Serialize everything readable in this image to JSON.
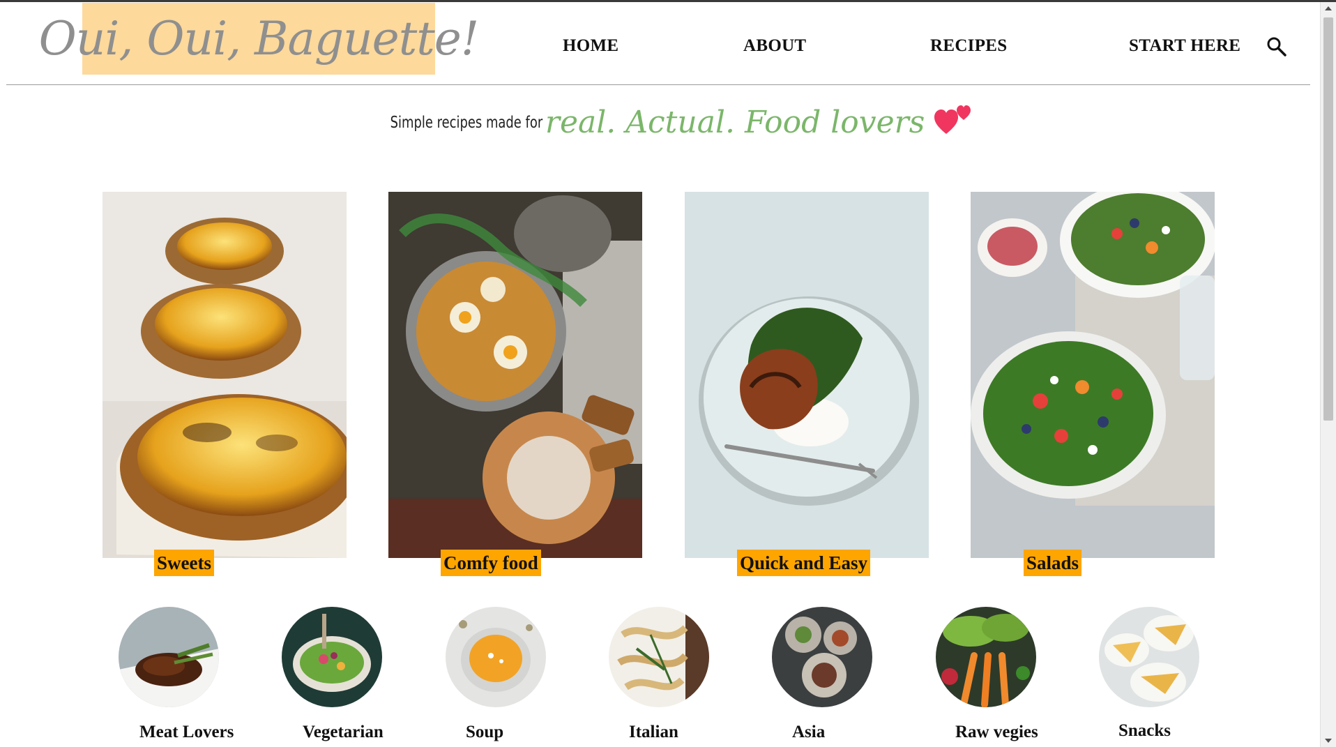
{
  "header": {
    "logo": "Oui, Oui, Baguette!",
    "nav": [
      "HOME",
      "ABOUT",
      "RECIPES",
      "START HERE"
    ],
    "search_icon": "search-icon"
  },
  "tagline": {
    "prefix": "Simple recipes made for",
    "script": "real. Actual. Food lovers",
    "icon": "hearts-icon"
  },
  "categories": [
    {
      "label": "Sweets",
      "image": "egg tarts"
    },
    {
      "label": "Comfy food",
      "image": "shakshuka pan with bread"
    },
    {
      "label": "Quick and Easy",
      "image": "roast chicken plate"
    },
    {
      "label": "Salads",
      "image": "mixed salad bowls"
    }
  ],
  "collections": [
    {
      "label": "Meat Lovers",
      "image": "steak plate"
    },
    {
      "label": "Vegetarian",
      "image": "veggie bowl"
    },
    {
      "label": "Soup",
      "image": "pumpkin soup"
    },
    {
      "label": "Italian",
      "image": "pasta"
    },
    {
      "label": "Asia",
      "image": "asian plates"
    },
    {
      "label": "Raw vegies",
      "image": "raw vegetables"
    },
    {
      "label": "Snacks",
      "image": "crepes"
    }
  ],
  "colors": {
    "logo_bg": "#fdd99b",
    "logo_text": "#8f8f8f",
    "script_green": "#7bb66a",
    "heart_pink": "#f0365f",
    "label_bg": "#ffa500"
  }
}
